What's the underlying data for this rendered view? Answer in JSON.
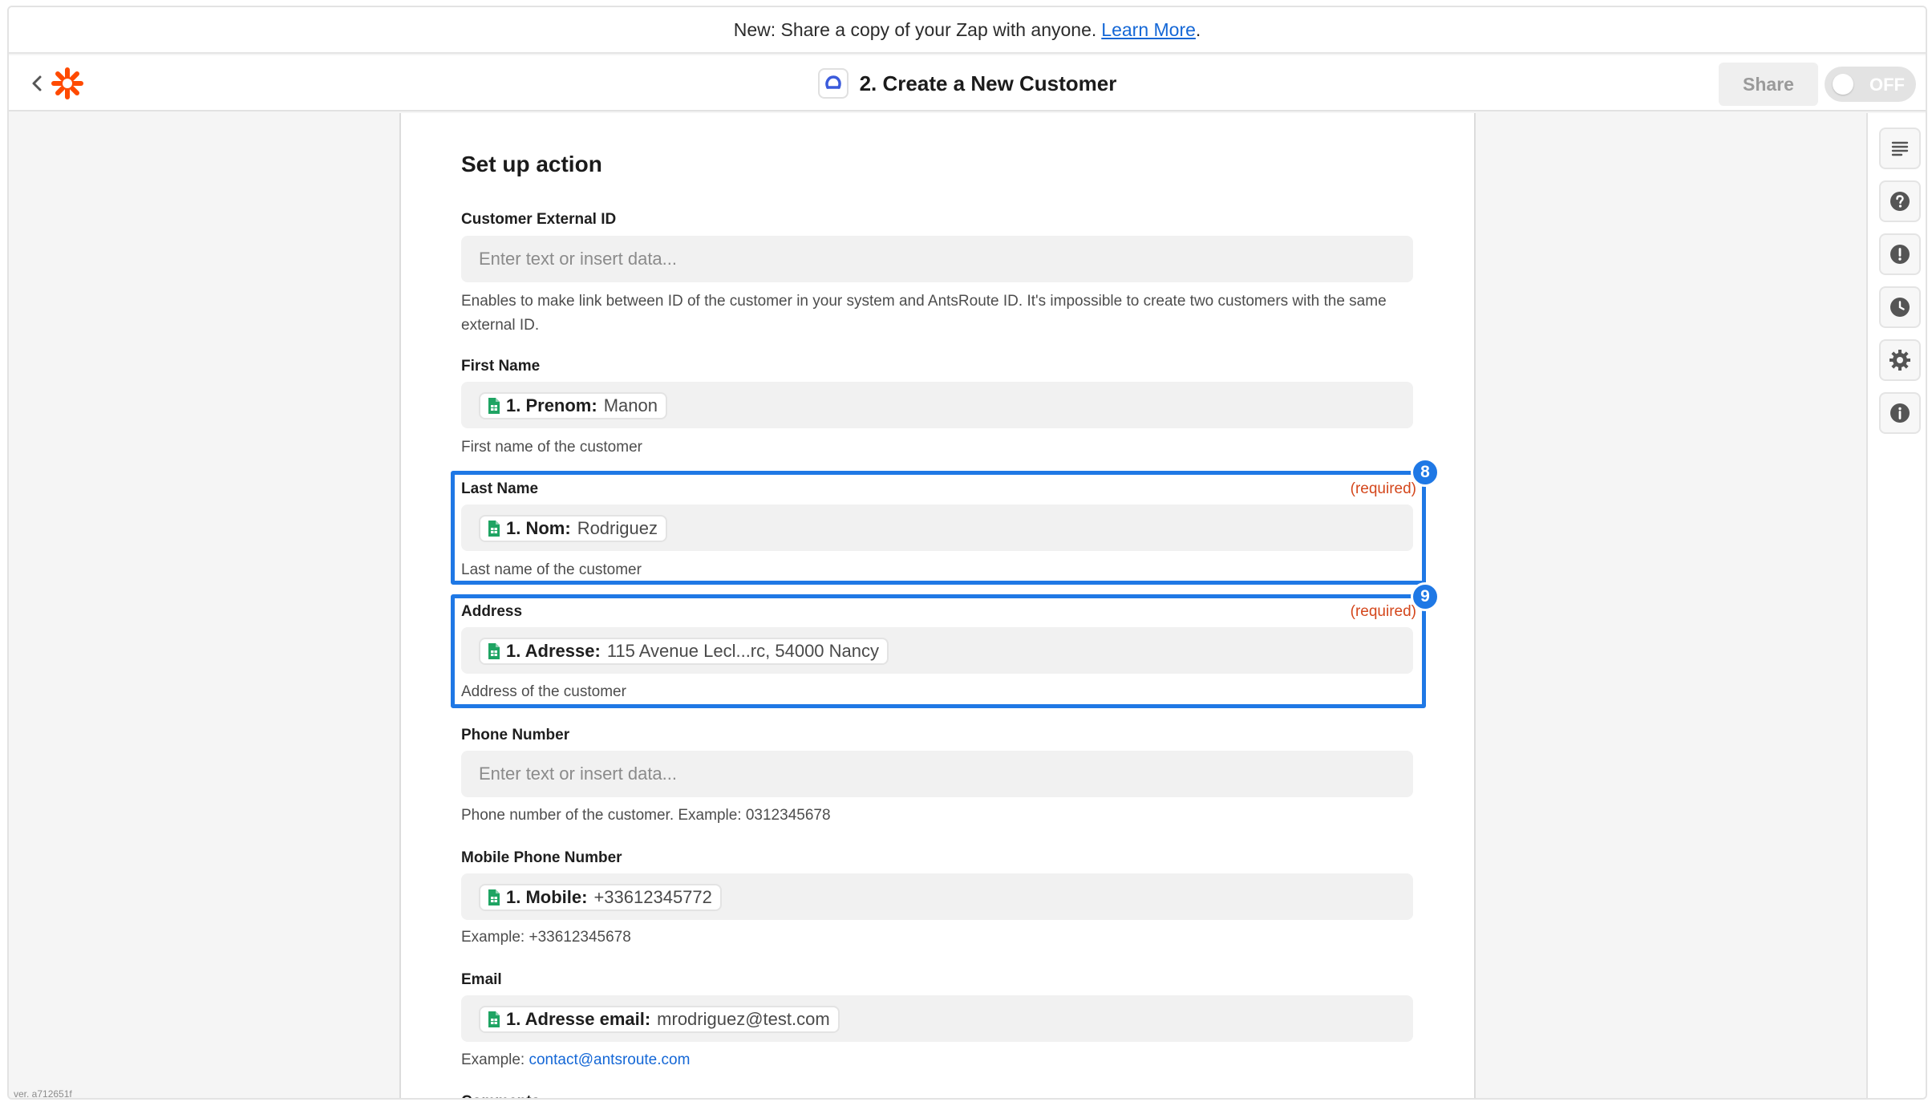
{
  "announcement": {
    "text": "New: Share a copy of your Zap with anyone.",
    "link": "Learn More",
    "suffix": "."
  },
  "header": {
    "back_icon": "chevron-left-icon",
    "logo": "zapier-asterisk-logo",
    "title": "2. Create a New Customer",
    "share_label": "Share",
    "toggle_label": "OFF",
    "colors": {
      "brand": "#ff4a00",
      "app_accent": "#3b5bdb"
    }
  },
  "panel": {
    "title": "Set up action",
    "fields": [
      {
        "label": "Customer External ID",
        "required": "",
        "placeholder": "Enter text or insert data...",
        "pill_key": "",
        "pill_value": "",
        "help": "Enables to make link between ID of the customer in your system and AntsRoute ID. It's impossible to create two customers with the same external ID.",
        "help_link": ""
      },
      {
        "label": "First Name",
        "required": "",
        "placeholder": "",
        "pill_key": "1. Prenom:",
        "pill_value": "Manon",
        "help": "First name of the customer",
        "help_link": ""
      },
      {
        "label": "Last Name",
        "required": "(required)",
        "placeholder": "",
        "pill_key": "1. Nom:",
        "pill_value": "Rodriguez",
        "help": "Last name of the customer",
        "help_link": ""
      },
      {
        "label": "Address",
        "required": "(required)",
        "placeholder": "",
        "pill_key": "1. Adresse:",
        "pill_value": "115 Avenue Lecl...rc, 54000 Nancy",
        "help": "Address of the customer",
        "help_link": ""
      },
      {
        "label": "Phone Number",
        "required": "",
        "placeholder": "Enter text or insert data...",
        "pill_key": "",
        "pill_value": "",
        "help": "Phone number of the customer. Example: 0312345678",
        "help_link": ""
      },
      {
        "label": "Mobile Phone Number",
        "required": "",
        "placeholder": "",
        "pill_key": "1. Mobile:",
        "pill_value": "+33612345772",
        "help": "Example: +33612345678",
        "help_link": ""
      },
      {
        "label": "Email",
        "required": "",
        "placeholder": "",
        "pill_key": "1. Adresse email:",
        "pill_value": "mrodriguez@test.com",
        "help": "Example: ",
        "help_link": "contact@antsroute.com"
      },
      {
        "label": "Comments",
        "required": "",
        "placeholder": "",
        "pill_key": "",
        "pill_value": "",
        "help": "",
        "help_link": ""
      }
    ],
    "badges": [
      "8",
      "9"
    ],
    "highlight_color": "#1f78e5"
  },
  "rightbar": {
    "icons": [
      "outline-icon",
      "help-icon",
      "alert-icon",
      "history-icon",
      "settings-icon",
      "info-icon"
    ]
  },
  "version": "ver. a712651f"
}
